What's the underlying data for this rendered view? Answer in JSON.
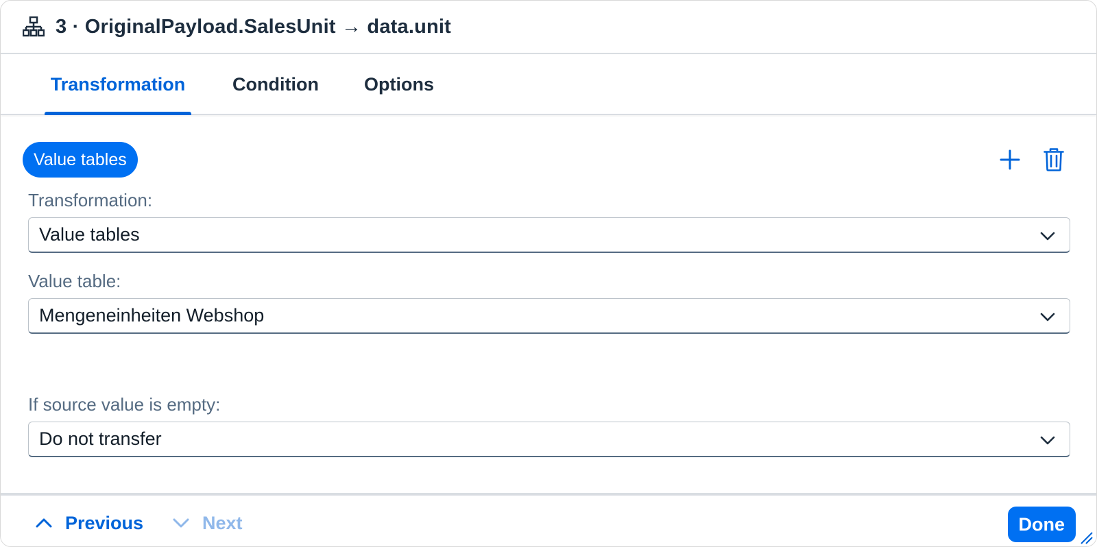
{
  "header": {
    "icon": "hierarchy-icon",
    "title": "3 · OriginalPayload.SalesUnit → data.unit"
  },
  "tabs": [
    {
      "label": "Transformation",
      "active": true
    },
    {
      "label": "Condition",
      "active": false
    },
    {
      "label": "Options",
      "active": false
    }
  ],
  "content": {
    "chip_label": "Value tables",
    "add_icon": "plus-icon",
    "delete_icon": "trash-icon",
    "transformation": {
      "label": "Transformation:",
      "value": "Value tables"
    },
    "value_table": {
      "label": "Value table:",
      "value": "Mengeneinheiten Webshop"
    },
    "if_empty": {
      "label": "If source value is empty:",
      "value": "Do not transfer"
    }
  },
  "footer": {
    "previous_label": "Previous",
    "next_label": "Next",
    "done_label": "Done"
  },
  "colors": {
    "accent": "#0070f2",
    "text": "#1d2d3e",
    "label": "#556b82",
    "disabled": "#90b8ea"
  }
}
